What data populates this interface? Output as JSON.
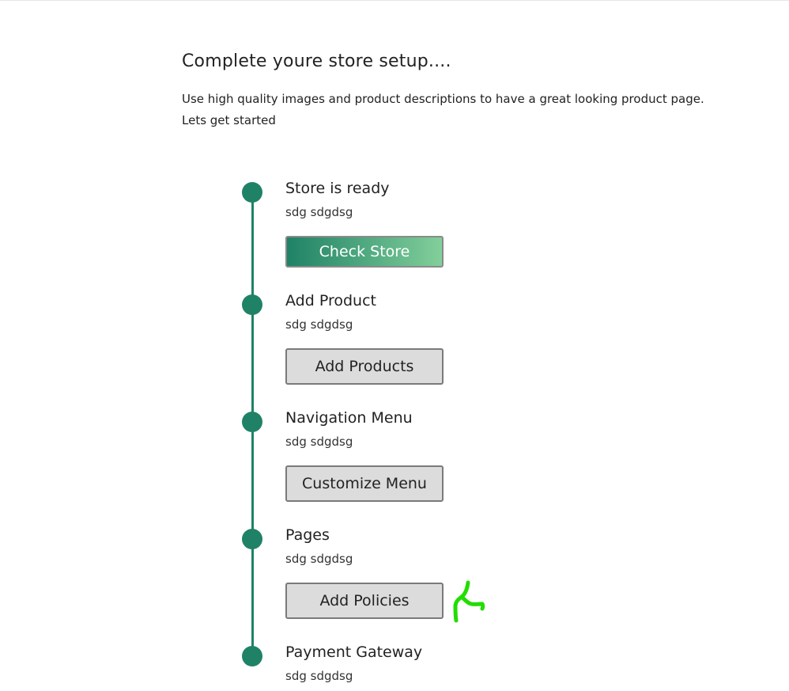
{
  "header": {
    "title": "Complete youre store setup....",
    "intro_line1": "Use high quality images and product descriptions to have a great looking product page.",
    "intro_line2": "Lets get started"
  },
  "steps": [
    {
      "title": "Store is ready",
      "subtitle": "sdg sdgdsg",
      "button": "Check Store"
    },
    {
      "title": "Add Product",
      "subtitle": "sdg sdgdsg",
      "button": "Add Products"
    },
    {
      "title": "Navigation Menu",
      "subtitle": "sdg sdgdsg",
      "button": "Customize Menu"
    },
    {
      "title": "Pages",
      "subtitle": "sdg sdgdsg",
      "button": "Add Policies"
    },
    {
      "title": "Payment Gateway",
      "subtitle": "sdg sdgdsg"
    }
  ],
  "colors": {
    "accent": "#1f8266",
    "accent_light": "#82cf9a",
    "button_bg": "#dcdcdc",
    "annotation": "#22dd00"
  }
}
